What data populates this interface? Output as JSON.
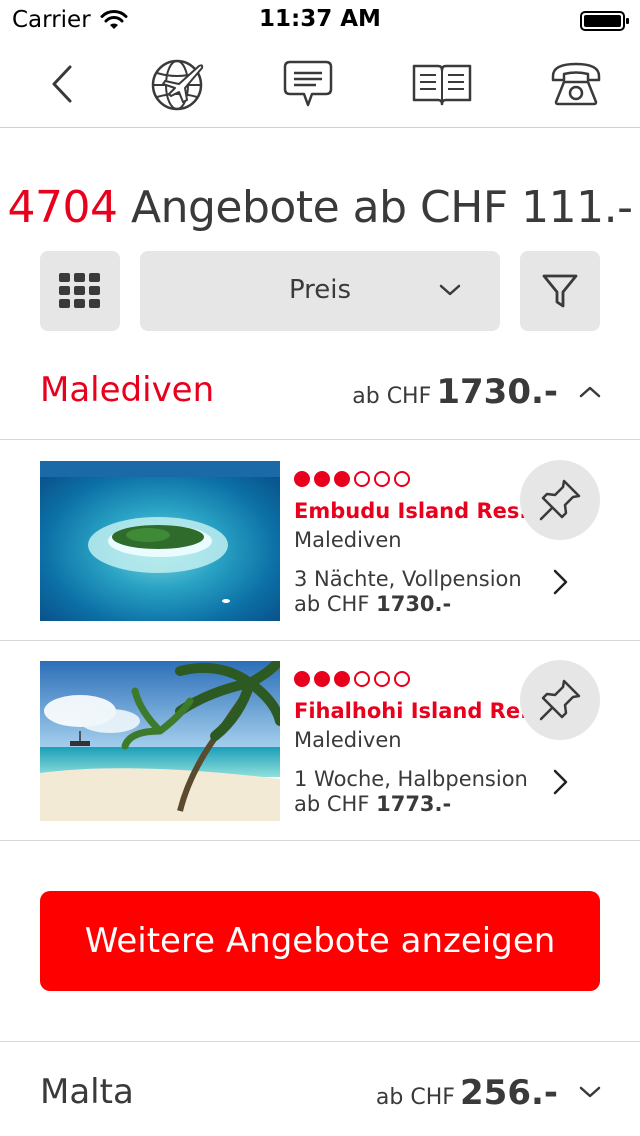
{
  "status_bar": {
    "carrier": "Carrier",
    "time": "11:37 AM"
  },
  "nav": {
    "icons": [
      "back-chevron-icon",
      "globe-plane-icon",
      "chat-bubble-icon",
      "open-book-icon",
      "telephone-icon"
    ]
  },
  "headline": {
    "count": "4704",
    "text": " Angebote ab CHF 111.-"
  },
  "toolbar": {
    "sort_value": "Preis"
  },
  "groups": [
    {
      "name": "Malediven",
      "ab_label": "ab CHF",
      "price": "1730.-",
      "expanded": true,
      "hotels": [
        {
          "rating": 3,
          "rating_max": 6,
          "name": "Embudu Island Res...",
          "region": "Malediven",
          "stay": "3 Nächte, Vollpension",
          "price_prefix": "ab CHF ",
          "price": "1730.-"
        },
        {
          "rating": 3,
          "rating_max": 6,
          "name": "Fihalhohi Island Re...",
          "region": "Malediven",
          "stay": "1 Woche, Halbpension",
          "price_prefix": "ab CHF ",
          "price": "1773.-"
        }
      ],
      "more_button": "Weitere Angebote anzeigen"
    },
    {
      "name": "Malta",
      "ab_label": "ab CHF",
      "price": "256.-",
      "expanded": false
    }
  ],
  "colors": {
    "accent": "#e8001c",
    "button_red": "#ff0000",
    "control_bg": "#e6e6e6",
    "text": "#3a3a3a"
  }
}
